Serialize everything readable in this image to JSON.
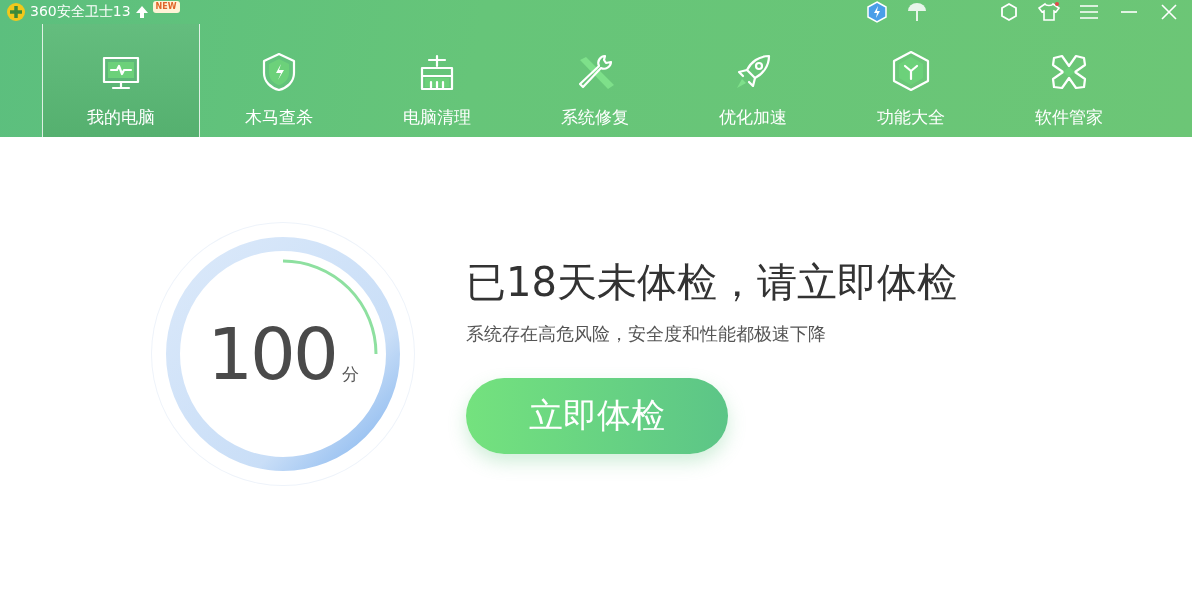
{
  "window": {
    "title": "360安全卫士13",
    "badge": "NEW"
  },
  "tabs": [
    {
      "label": "我的电脑",
      "selected": true
    },
    {
      "label": "木马查杀",
      "selected": false
    },
    {
      "label": "电脑清理",
      "selected": false
    },
    {
      "label": "系统修复",
      "selected": false
    },
    {
      "label": "优化加速",
      "selected": false
    },
    {
      "label": "功能大全",
      "selected": false
    },
    {
      "label": "软件管家",
      "selected": false
    }
  ],
  "score": {
    "value": "100",
    "unit": "分"
  },
  "headline": "已18天未体检，请立即体检",
  "subtitle": "系统存在高危风险，安全度和性能都极速下降",
  "check_button": "立即体检"
}
